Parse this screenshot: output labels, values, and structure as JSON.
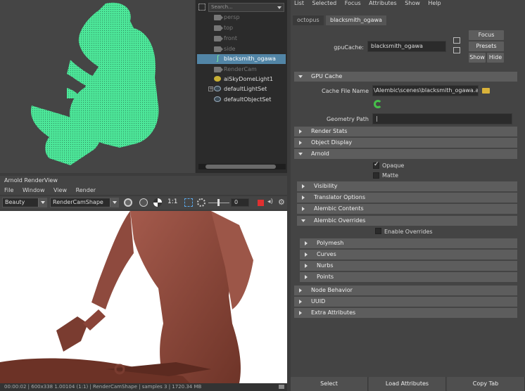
{
  "outliner": {
    "search_placeholder": "Search...",
    "items": [
      {
        "label": "persp",
        "icon": "camera-icon",
        "dim": true
      },
      {
        "label": "top",
        "icon": "camera-icon",
        "dim": true
      },
      {
        "label": "front",
        "icon": "camera-icon",
        "dim": true
      },
      {
        "label": "side",
        "icon": "camera-icon",
        "dim": true
      },
      {
        "label": "blacksmith_ogawa",
        "icon": "gpu-cache-icon",
        "selected": true
      },
      {
        "label": "RenderCam",
        "icon": "camera-icon",
        "dim": true
      },
      {
        "label": "aiSkyDomeLight1",
        "icon": "light-icon"
      },
      {
        "label": "defaultLightSet",
        "icon": "set-icon",
        "expandable": true
      },
      {
        "label": "defaultObjectSet",
        "icon": "set-icon"
      }
    ]
  },
  "renderview": {
    "title": "Arnold RenderView",
    "menu": [
      "File",
      "Window",
      "View",
      "Render"
    ],
    "aov": "Beauty",
    "camera": "RenderCamShape",
    "zoom_label": "1:1",
    "exposure": "0",
    "status": "00:00:02 | 600x338 1.00104 (1:1) | RenderCamShape | samples 3 | 1720.34 MB"
  },
  "attribute_editor": {
    "menu": [
      "List",
      "Selected",
      "Focus",
      "Attributes",
      "Show",
      "Help"
    ],
    "tabs": [
      "octopus",
      "blacksmith_ogawa"
    ],
    "node_label": "gpuCache:",
    "node_value": "blacksmith_ogawa",
    "focus_button": "Focus",
    "presets_button": "Presets",
    "show_button": "Show",
    "hide_button": "Hide",
    "gpu_cache_section": "GPU Cache",
    "cache_file_label": "Cache File Name",
    "cache_file_value": "\\Alembic\\scenes\\blacksmith_ogawa.abc",
    "geometry_path_label": "Geometry Path",
    "geometry_path_value": "|",
    "sections_a": [
      "Render Stats",
      "Object Display"
    ],
    "arnold_section": "Arnold",
    "opaque_label": "Opaque",
    "matte_label": "Matte",
    "arnold_sub": [
      "Visibility",
      "Translator Options",
      "Alembic Contents"
    ],
    "alembic_overrides": "Alembic Overrides",
    "enable_overrides_label": "Enable Overrides",
    "override_sub": [
      "Polymesh",
      "Curves",
      "Nurbs",
      "Points"
    ],
    "sections_b": [
      "Node Behavior",
      "UUID",
      "Extra Attributes"
    ],
    "bottom_buttons": [
      "Select",
      "Load Attributes",
      "Copy Tab"
    ]
  },
  "colors": {
    "accent": "#5285a6",
    "mesh": "#4de89a",
    "render_figure": "#8a4a3e"
  }
}
